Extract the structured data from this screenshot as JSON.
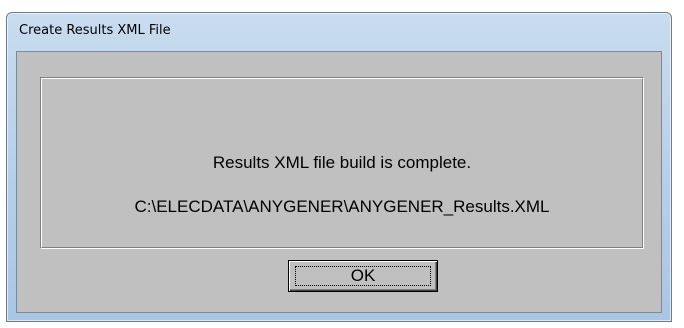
{
  "window": {
    "title": "Create Results XML File"
  },
  "dialog": {
    "message": "Results XML file build is complete.",
    "path": "C:\\ELECDATA\\ANYGENER\\ANYGENER_Results.XML",
    "ok_label": "OK"
  },
  "colors": {
    "dialog_background": "#c0c0c0",
    "titlebar": "#b9d1ea"
  }
}
